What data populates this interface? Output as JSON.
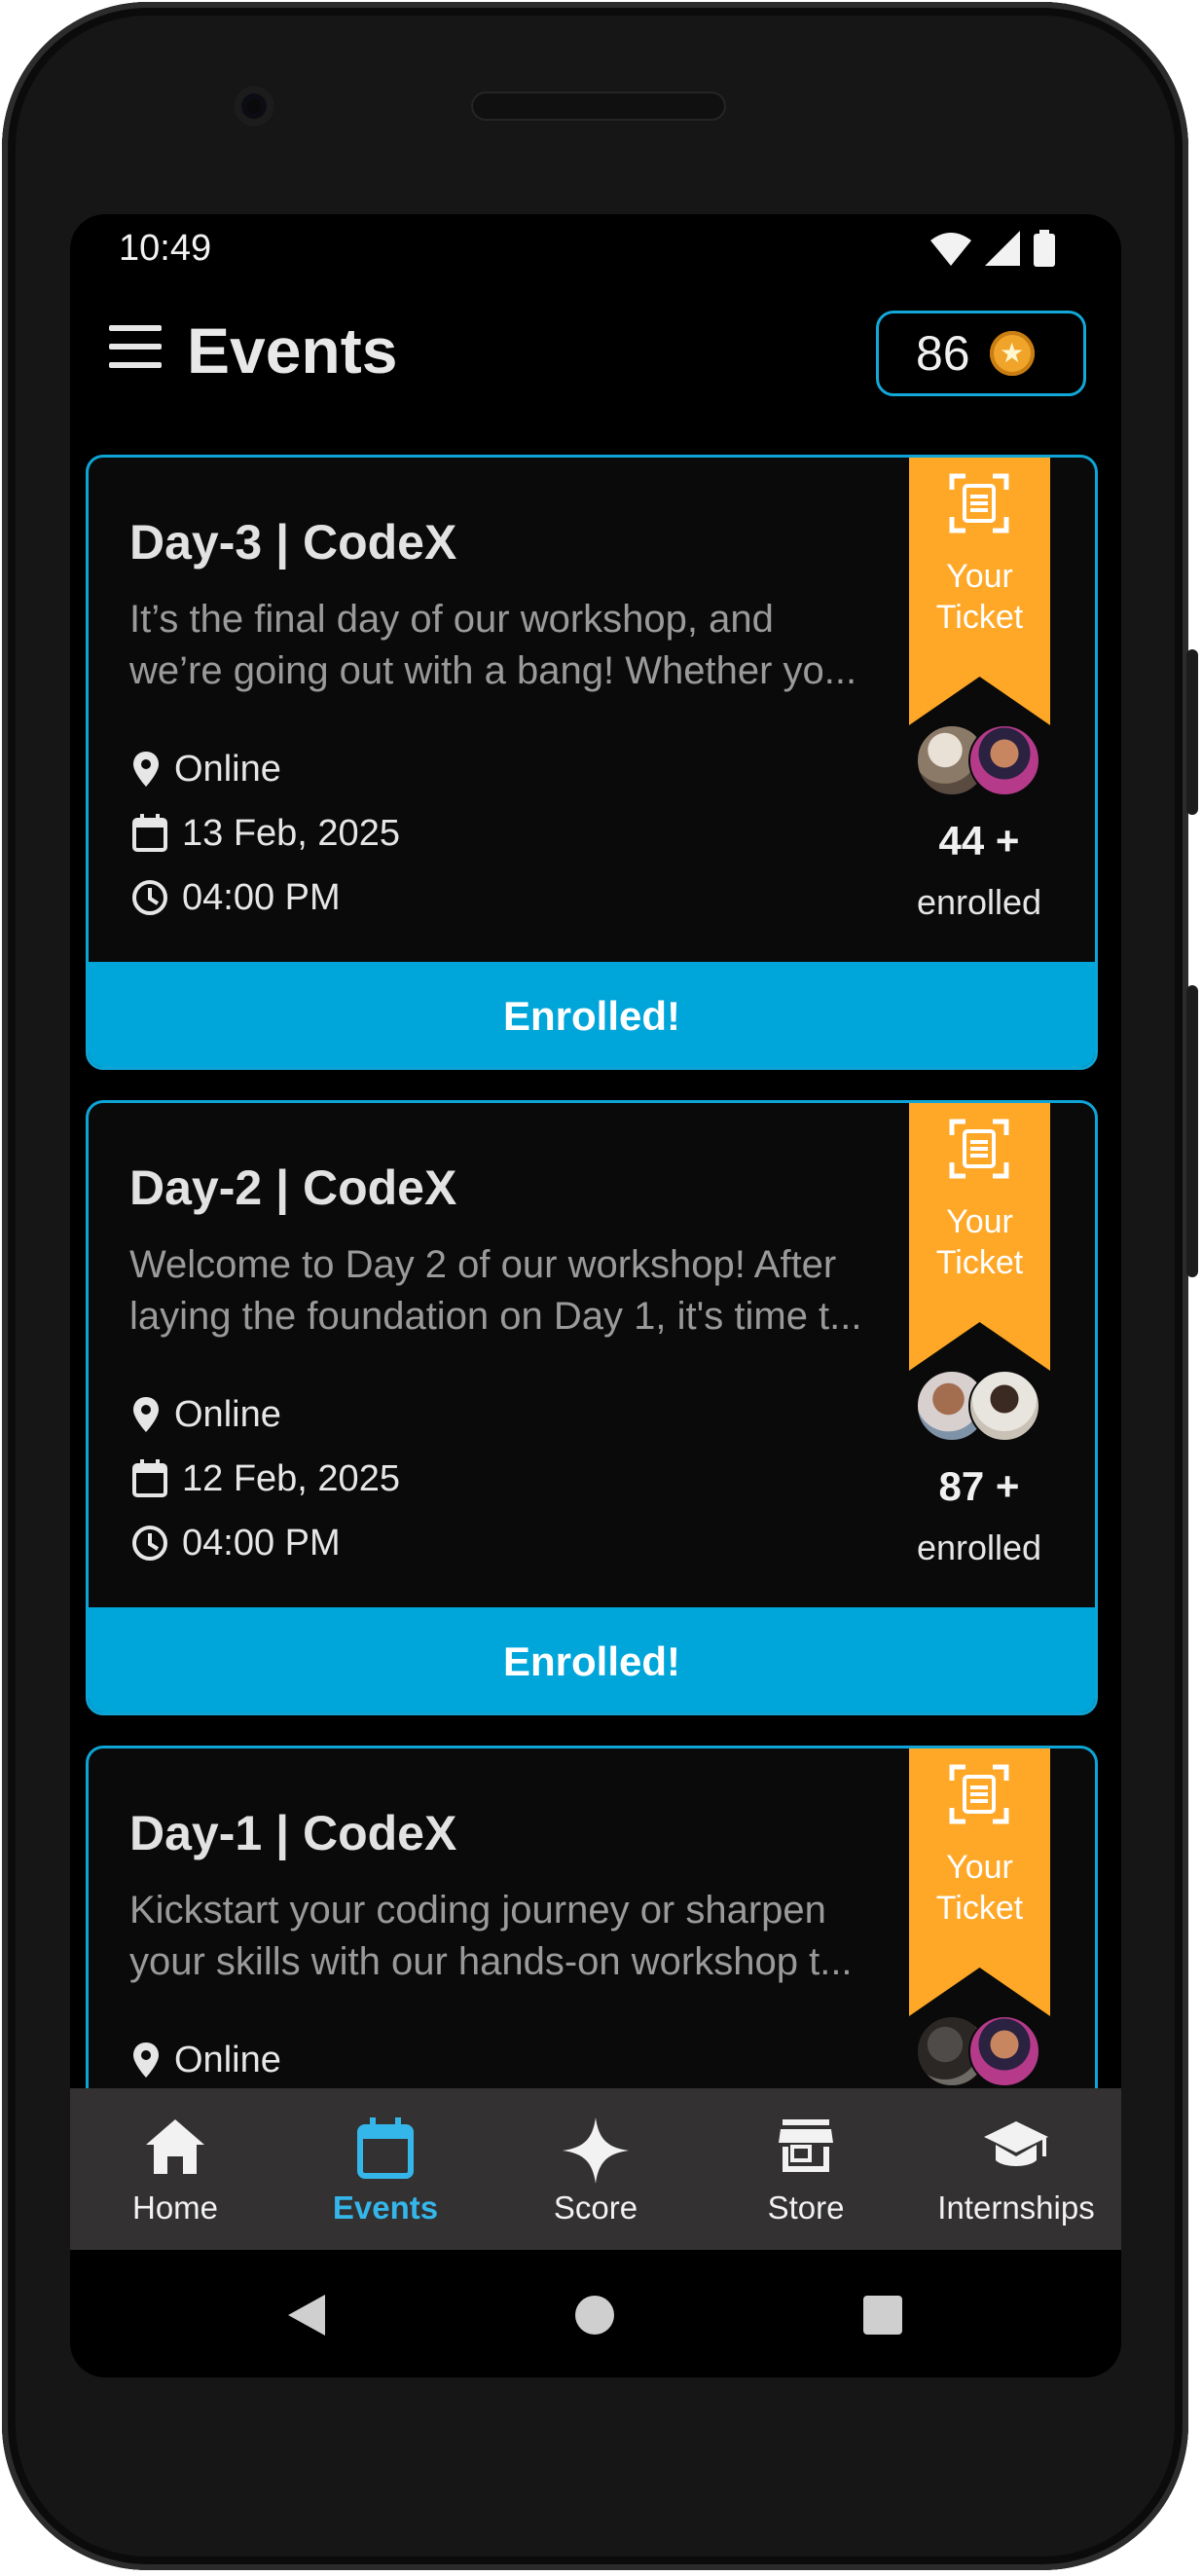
{
  "status_bar": {
    "time": "10:49"
  },
  "header": {
    "title": "Events",
    "coins": "86"
  },
  "events": [
    {
      "title": "Day-3 | CodeX",
      "description_line1": "It’s the final day of our workshop, and",
      "description_line2": "we’re going out with a bang! Whether yo...",
      "location": "Online",
      "date": "13 Feb, 2025",
      "time": "04:00 PM",
      "ticket_label": "Your Ticket",
      "enrolled_count": "44 +",
      "enrolled_word": "enrolled",
      "button_label": "Enrolled!"
    },
    {
      "title": "Day-2 | CodeX",
      "description_line1": "Welcome to Day 2 of our workshop! After",
      "description_line2": "laying the foundation on Day 1, it's time t...",
      "location": "Online",
      "date": "12 Feb, 2025",
      "time": "04:00 PM",
      "ticket_label": "Your Ticket",
      "enrolled_count": "87 +",
      "enrolled_word": "enrolled",
      "button_label": "Enrolled!"
    },
    {
      "title": "Day-1 | CodeX",
      "description_line1": "Kickstart your coding journey or sharpen",
      "description_line2": "your skills with our hands-on workshop t...",
      "location": "Online",
      "ticket_label": "Your Ticket"
    }
  ],
  "bottom_nav": {
    "items": [
      {
        "label": "Home",
        "icon": "home-icon"
      },
      {
        "label": "Events",
        "icon": "calendar-icon",
        "active": true
      },
      {
        "label": "Score",
        "icon": "sparkle-icon"
      },
      {
        "label": "Store",
        "icon": "store-icon"
      },
      {
        "label": "Internships",
        "icon": "graduation-cap-icon"
      }
    ]
  },
  "colors": {
    "accent": "#00a6d9",
    "ribbon": "#ffa726",
    "active_nav": "#35b6ea",
    "nav_background": "#333131",
    "card_border": "#0ea5d6"
  }
}
